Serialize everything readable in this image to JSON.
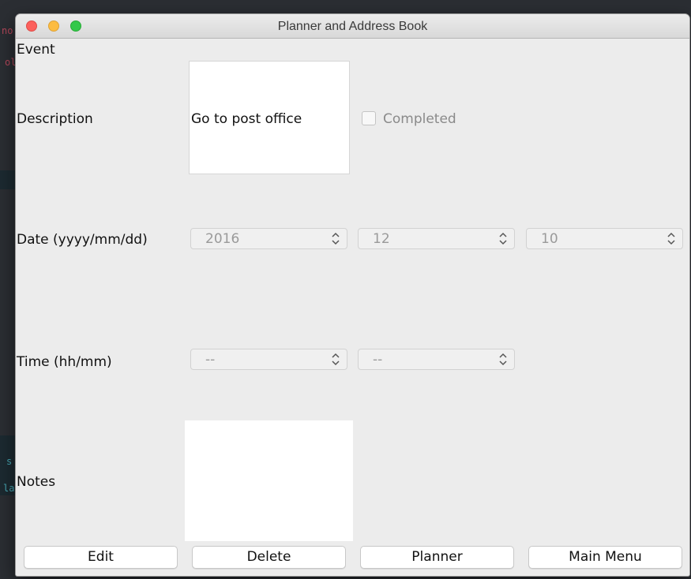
{
  "window": {
    "title": "Planner and Address Book"
  },
  "form": {
    "section_label": "Event",
    "description": {
      "label": "Description",
      "value": "Go to post office"
    },
    "completed": {
      "label": "Completed",
      "checked": false
    },
    "date": {
      "label": "Date (yyyy/mm/dd)",
      "year": "2016",
      "month": "12",
      "day": "10"
    },
    "time": {
      "label": "Time (hh/mm)",
      "hour": "--",
      "minute": "--"
    },
    "notes": {
      "label": "Notes",
      "value": ""
    }
  },
  "buttons": {
    "edit": "Edit",
    "delete": "Delete",
    "planner": "Planner",
    "main_menu": "Main Menu"
  },
  "background": {
    "fragments": [
      "no",
      "ol",
      "s",
      "la"
    ]
  },
  "colors": {
    "window_bg": "#ececec",
    "close": "#fc605c",
    "minimize": "#fdbc40",
    "zoom": "#34c84a"
  }
}
